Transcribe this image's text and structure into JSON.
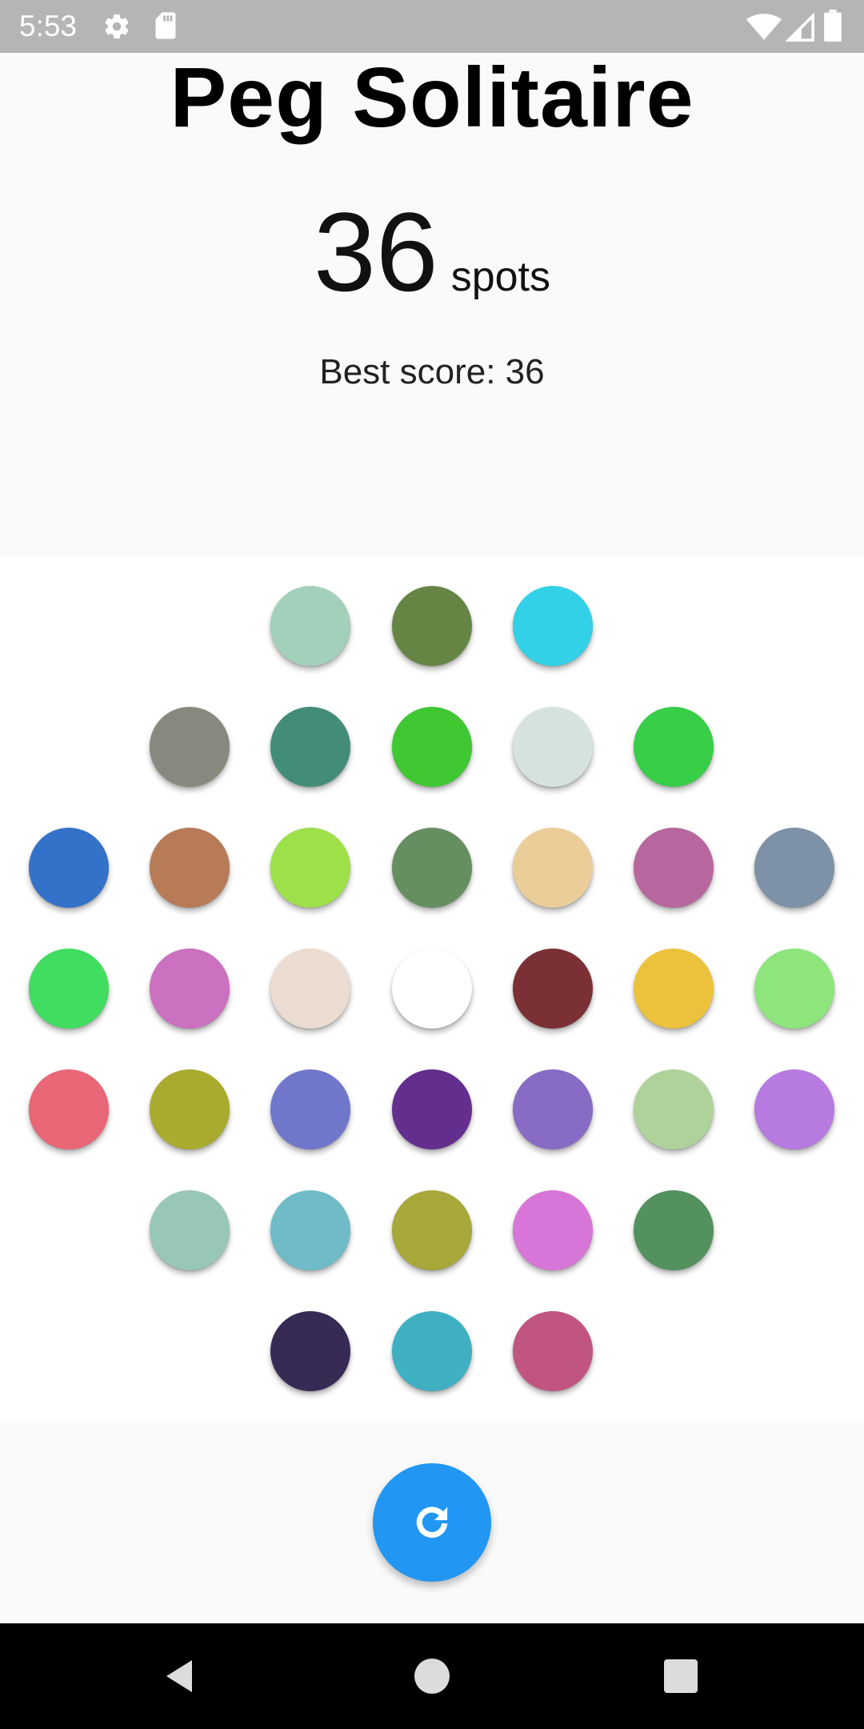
{
  "status_bar": {
    "time": "5:53",
    "icons": [
      "gear-icon",
      "sd-card-icon",
      "wifi-icon",
      "signal-icon",
      "battery-icon"
    ]
  },
  "game": {
    "title": "Peg Solitaire",
    "score_value": "36",
    "score_unit": "spots",
    "best_score_text": "Best score: 36"
  },
  "board": {
    "rows": [
      {
        "cols": [
          2,
          3,
          4
        ],
        "colors": [
          "#a3d0bb",
          "#668545",
          "#32d1e8"
        ]
      },
      {
        "cols": [
          1,
          2,
          3,
          4,
          5
        ],
        "colors": [
          "#868a7e",
          "#438c78",
          "#3fc832",
          "#d6e2e0",
          "#38ce48"
        ]
      },
      {
        "cols": [
          0,
          1,
          2,
          3,
          4,
          5,
          6
        ],
        "colors": [
          "#3471c8",
          "#b77b57",
          "#9ee04a",
          "#668f61",
          "#eacd98",
          "#b7679d",
          "#7d91a7"
        ]
      },
      {
        "cols": [
          0,
          1,
          2,
          3,
          4,
          5,
          6
        ],
        "colors": [
          "#40dd60",
          "#cc70c0",
          "#eadcd0",
          "#ffffff",
          "#7b3035",
          "#ecc23c",
          "#8de57c"
        ]
      },
      {
        "cols": [
          0,
          1,
          2,
          3,
          4,
          5,
          6
        ],
        "colors": [
          "#e86676",
          "#a9ab2f",
          "#7077cb",
          "#632e8d",
          "#886bc5",
          "#aed29a",
          "#b77ae0"
        ]
      },
      {
        "cols": [
          1,
          2,
          3,
          4,
          5
        ],
        "colors": [
          "#98c6b7",
          "#6fbcc8",
          "#a6a83a",
          "#d875d8",
          "#53915e"
        ]
      },
      {
        "cols": [
          2,
          3,
          4
        ],
        "colors": [
          "#372b56",
          "#3eb0c2",
          "#c05582"
        ]
      }
    ]
  },
  "reset_button": {
    "icon": "refresh-icon",
    "color": "#2196f3"
  },
  "nav_bar": {
    "icons": [
      "back-icon",
      "home-icon",
      "recent-apps-icon"
    ]
  }
}
